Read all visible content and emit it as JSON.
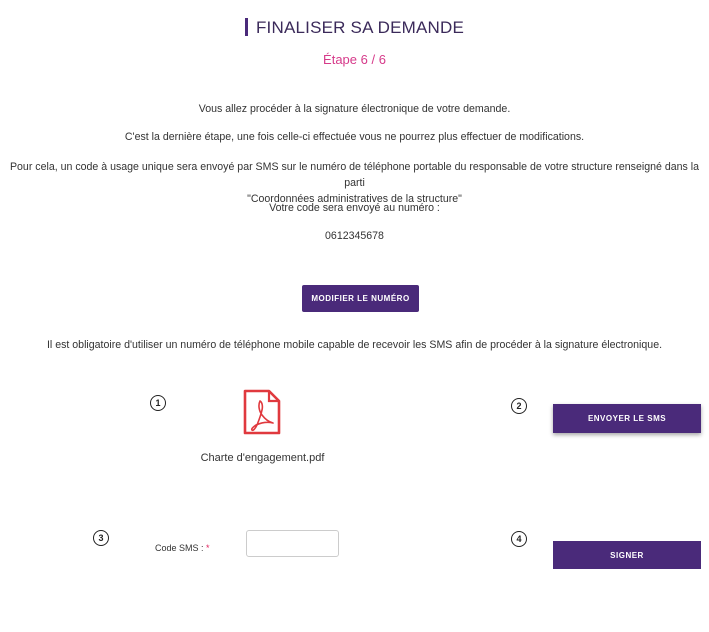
{
  "header": {
    "title": "FINALISER SA DEMANDE",
    "step": "Étape 6 / 6"
  },
  "intro": {
    "line1": "Vous allez procéder à la signature électronique de votre demande.",
    "line2": "C'est la dernière étape, une fois celle-ci effectuée vous ne pourrez plus effectuer de modifications.",
    "line3a": "Pour cela, un code à usage unique sera envoyé par SMS sur le numéro de téléphone portable du responsable de votre structure renseigné dans la parti",
    "line3b": "\"Coordonnées administratives de la structure\"",
    "line4": "Votre code sera envoyé au numéro :",
    "phone": "0612345678"
  },
  "buttons": {
    "modify": "MODIFIER LE NUMÉRO",
    "send_sms": "ENVOYER LE SMS",
    "sign": "SIGNER"
  },
  "notice": "Il est obligatoire d'utiliser un numéro de téléphone mobile capable de recevoir les SMS afin de procéder à la signature électronique.",
  "steps": {
    "s1": "1",
    "s2": "2",
    "s3": "3",
    "s4": "4"
  },
  "document": {
    "filename": "Charte d'engagement.pdf",
    "icon": "pdf-file-icon",
    "icon_color": "#e0393e"
  },
  "code": {
    "label": "Code SMS :",
    "required_mark": "*",
    "value": ""
  },
  "colors": {
    "primary": "#4a2a7a",
    "accent": "#d63a8a"
  }
}
